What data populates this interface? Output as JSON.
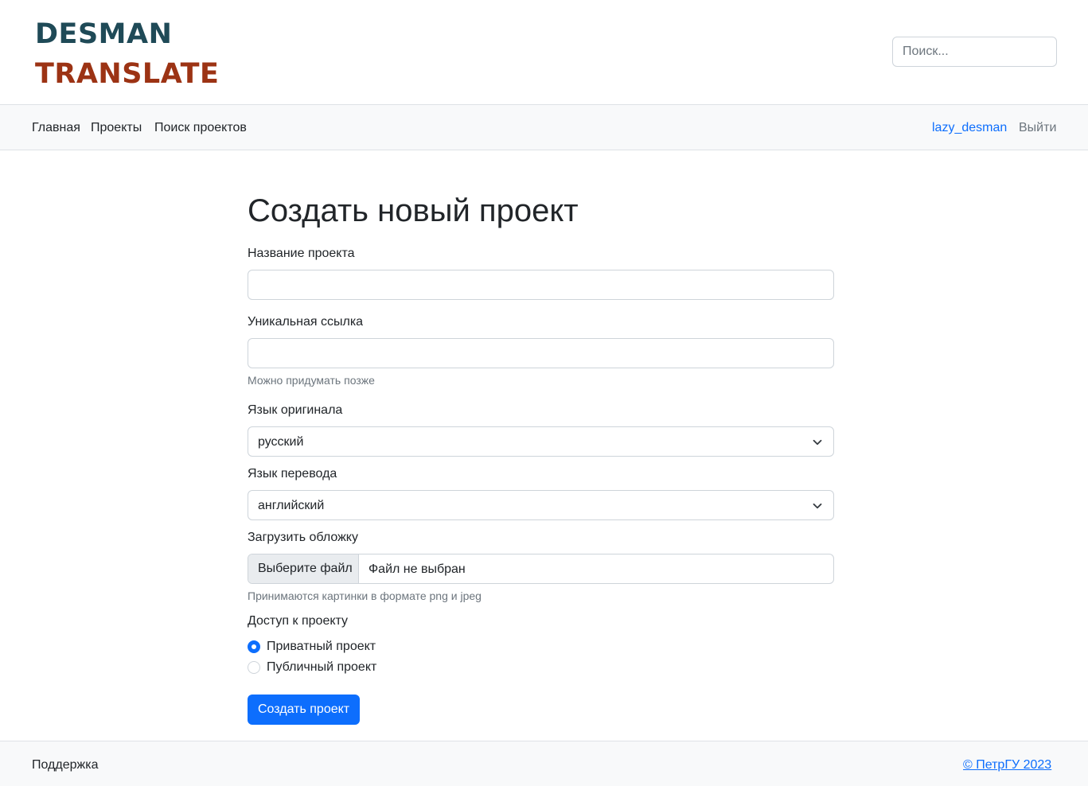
{
  "header": {
    "logo_line1": "DESMAN",
    "logo_line2": "TRANSLATE",
    "search_placeholder": "Поиск..."
  },
  "nav": {
    "items": [
      {
        "label": "Главная"
      },
      {
        "label": "Проекты"
      },
      {
        "label": "Поиск проектов"
      }
    ],
    "user": "lazy_desman",
    "logout": "Выйти"
  },
  "form": {
    "title": "Создать новый проект",
    "name_label": "Название проекта",
    "name_value": "",
    "link_label": "Уникальная ссылка",
    "link_value": "",
    "link_hint": "Можно придумать позже",
    "source_lang_label": "Язык оригинала",
    "source_lang_value": "русский",
    "target_lang_label": "Язык перевода",
    "target_lang_value": "английский",
    "cover_label": "Загрузить обложку",
    "cover_button": "Выберите файл",
    "cover_filename": "Файл не выбран",
    "cover_hint": "Принимаются картинки в формате png и jpeg",
    "access_label": "Доступ к проекту",
    "access_options": [
      {
        "label": "Приватный проект",
        "checked": true
      },
      {
        "label": "Публичный проект",
        "checked": false
      }
    ],
    "submit_label": "Создать проект"
  },
  "footer": {
    "support": "Поддержка",
    "copyright": "© ПетрГУ 2023"
  },
  "colors": {
    "logo_primary": "#1f4a57",
    "logo_secondary": "#9c3314",
    "accent": "#0d6efd"
  },
  "icons": {
    "select_arrow": "chevron-down-icon"
  }
}
